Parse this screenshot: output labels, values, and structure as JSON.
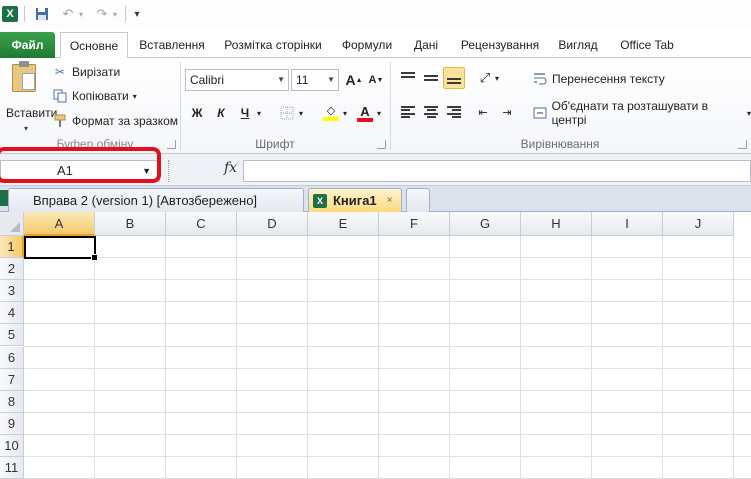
{
  "app": {
    "logo": "X"
  },
  "qat": {
    "icons": [
      "excel-logo-icon",
      "save-icon",
      "undo-icon",
      "redo-icon",
      "customize-icon"
    ]
  },
  "tabs": {
    "file": "Файл",
    "items": [
      "Основне",
      "Вставлення",
      "Розмітка сторінки",
      "Формули",
      "Дані",
      "Рецензування",
      "Вигляд",
      "Office Tab"
    ],
    "active_index": 0
  },
  "ribbon": {
    "clipboard": {
      "paste": "Вставити",
      "cut": "Вирізати",
      "copy": "Копіювати",
      "format_painter": "Формат за зразком",
      "group_label": "Буфер обміну"
    },
    "font": {
      "name": "Calibri",
      "size": "11",
      "bold": "Ж",
      "italic": "К",
      "underline": "Ч",
      "grow": "A",
      "shrink": "A",
      "group_label": "Шрифт",
      "fill_color": "#ffff00",
      "font_color": "#e2101a"
    },
    "alignment": {
      "wrap_text": "Перенесення тексту",
      "merge_center": "Об'єднати та розташувати в центрі",
      "group_label": "Вирівнювання"
    }
  },
  "formula_bar": {
    "name_box": "A1",
    "fx": "fx",
    "formula": ""
  },
  "office_tabs": [
    {
      "label": "Вправа 2 (version 1) [Автозбережено]",
      "active": false
    },
    {
      "label": "Книга1",
      "active": true,
      "close": "×"
    }
  ],
  "sheet": {
    "columns": [
      "A",
      "B",
      "C",
      "D",
      "E",
      "F",
      "G",
      "H",
      "I",
      "J"
    ],
    "rows": [
      "1",
      "2",
      "3",
      "4",
      "5",
      "6",
      "7",
      "8",
      "9",
      "10",
      "11"
    ],
    "active_cell": "A1",
    "selection_color": "#f6c96a",
    "highlight_color": "#e2101a"
  }
}
